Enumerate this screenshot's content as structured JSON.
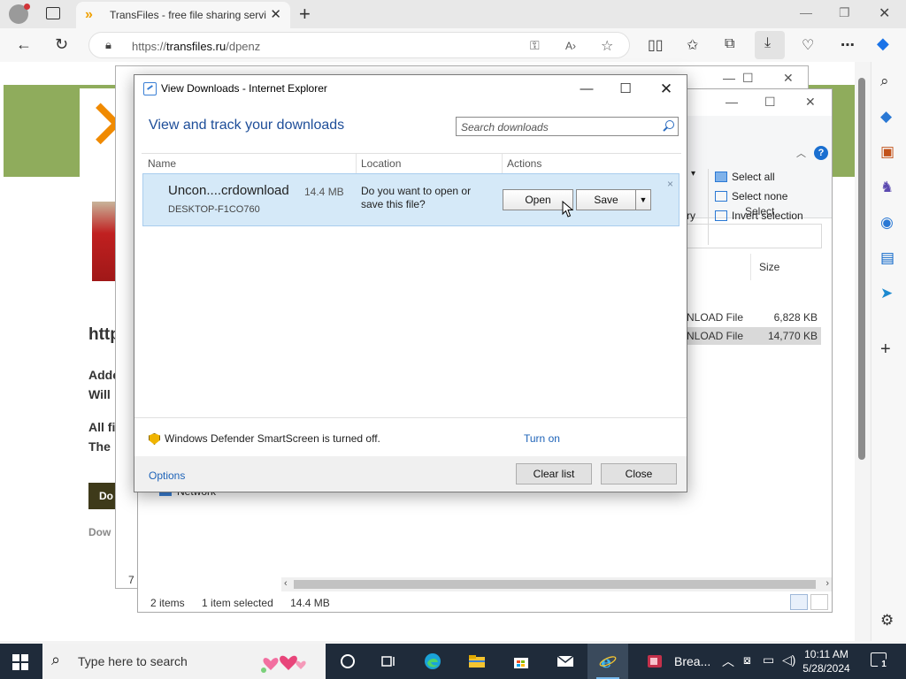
{
  "browser": {
    "tab_title": "TransFiles - free file sharing servi",
    "url_scheme": "https://",
    "url_host": "transfiles.ru",
    "url_path": "/dpenz"
  },
  "webpage": {
    "heading_fragment": "http",
    "line1": "Adde",
    "line2": "Will",
    "line3": "All fi",
    "line4": "The",
    "download_btn": "Do",
    "small_text": "Dow"
  },
  "explorer_back": {
    "status": "7 i"
  },
  "explorer": {
    "ribbon": {
      "select_all": "Select all",
      "select_none": "Select none",
      "invert_selection": "Invert selection",
      "group_label": "Select",
      "cut_label": "ry"
    },
    "column_size": "Size",
    "rows": [
      {
        "type": "NLOAD File",
        "size": "6,828 KB",
        "selected": false
      },
      {
        "type": "NLOAD File",
        "size": "14,770 KB",
        "selected": true
      }
    ],
    "network_label": "Network",
    "status": {
      "items": "2 items",
      "selected": "1 item selected",
      "size": "14.4 MB"
    }
  },
  "dialog": {
    "title": "View Downloads - Internet Explorer",
    "heading": "View and track your downloads",
    "search_placeholder": "Search downloads",
    "columns": {
      "name": "Name",
      "location": "Location",
      "actions": "Actions"
    },
    "item": {
      "filename": "Uncon....crdownload",
      "size": "14.4 MB",
      "host": "DESKTOP-F1CO760",
      "question": "Do you want to open or save this file?",
      "open_label": "Open",
      "save_label": "Save",
      "dismiss": "×"
    },
    "smartscreen_text": "Windows Defender SmartScreen is turned off.",
    "turn_on": "Turn on",
    "options": "Options",
    "clear_list": "Clear list",
    "close": "Close"
  },
  "taskbar": {
    "search_placeholder": "Type here to search",
    "app_label": "Brea...",
    "time": "10:11 AM",
    "date": "5/28/2024",
    "notification_count": "1"
  },
  "colors": {
    "accent": "#1e4e99",
    "selection": "#d5e9f8",
    "link": "#1e63b8",
    "taskbar": "#1f2b3a"
  }
}
